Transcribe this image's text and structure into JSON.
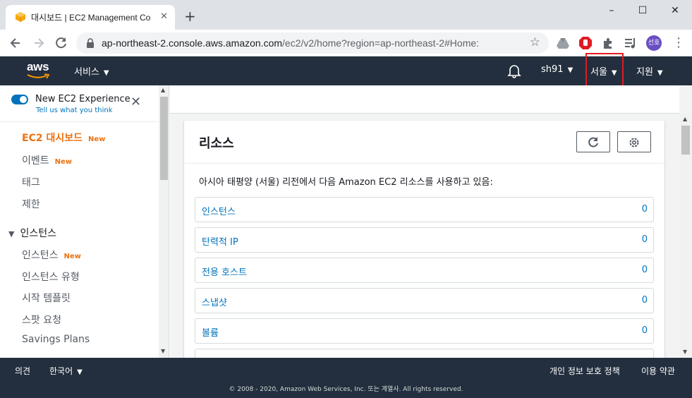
{
  "browser": {
    "tab_title": "대시보드 | EC2 Management Co",
    "tab_close": "✕",
    "new_tab": "+",
    "url_host": "ap-northeast-2.console.aws.amazon.com",
    "url_path": "/ec2/v2/home?region=ap-northeast-2#Home:",
    "profile_initials": "선호",
    "window_controls": [
      "–",
      "☐",
      "✕"
    ]
  },
  "header": {
    "logo": "aws",
    "services": "서비스",
    "user": "sh91",
    "region": "서울",
    "support": "지원"
  },
  "sidebar": {
    "experience_title": "New EC2 Experience",
    "experience_link": "Tell us what you think",
    "new_badge": "New",
    "items": [
      {
        "label": "EC2 대시보드",
        "badge": "New"
      },
      {
        "label": "이벤트",
        "badge": "New"
      },
      {
        "label": "태그"
      },
      {
        "label": "제한"
      }
    ],
    "section": "인스턴스",
    "section_items": [
      {
        "label": "인스턴스",
        "badge": "New"
      },
      {
        "label": "인스턴스 유형"
      },
      {
        "label": "시작 템플릿"
      },
      {
        "label": "스팟 요청"
      },
      {
        "label": "Savings Plans"
      }
    ]
  },
  "panel": {
    "title": "리소스",
    "description": "아시아 태평양 (서울) 리전에서 다음 Amazon EC2 리소스를 사용하고 있음:",
    "resources": [
      {
        "name": "인스턴스",
        "count": "0"
      },
      {
        "name": "탄력적 IP",
        "count": "0"
      },
      {
        "name": "전용 호스트",
        "count": "0"
      },
      {
        "name": "스냅샷",
        "count": "0"
      },
      {
        "name": "볼륨",
        "count": "0"
      }
    ]
  },
  "footer": {
    "feedback": "의견",
    "language": "한국어",
    "privacy": "개인 정보 보호 정책",
    "terms": "이용 약관",
    "copyright": "© 2008 - 2020, Amazon Web Services, Inc. 또는 계열사. All rights reserved."
  },
  "colors": {
    "aws_nav": "#232f3e",
    "accent_orange": "#ec7211",
    "link_blue": "#0073bb",
    "highlight_red": "#e01b24"
  }
}
